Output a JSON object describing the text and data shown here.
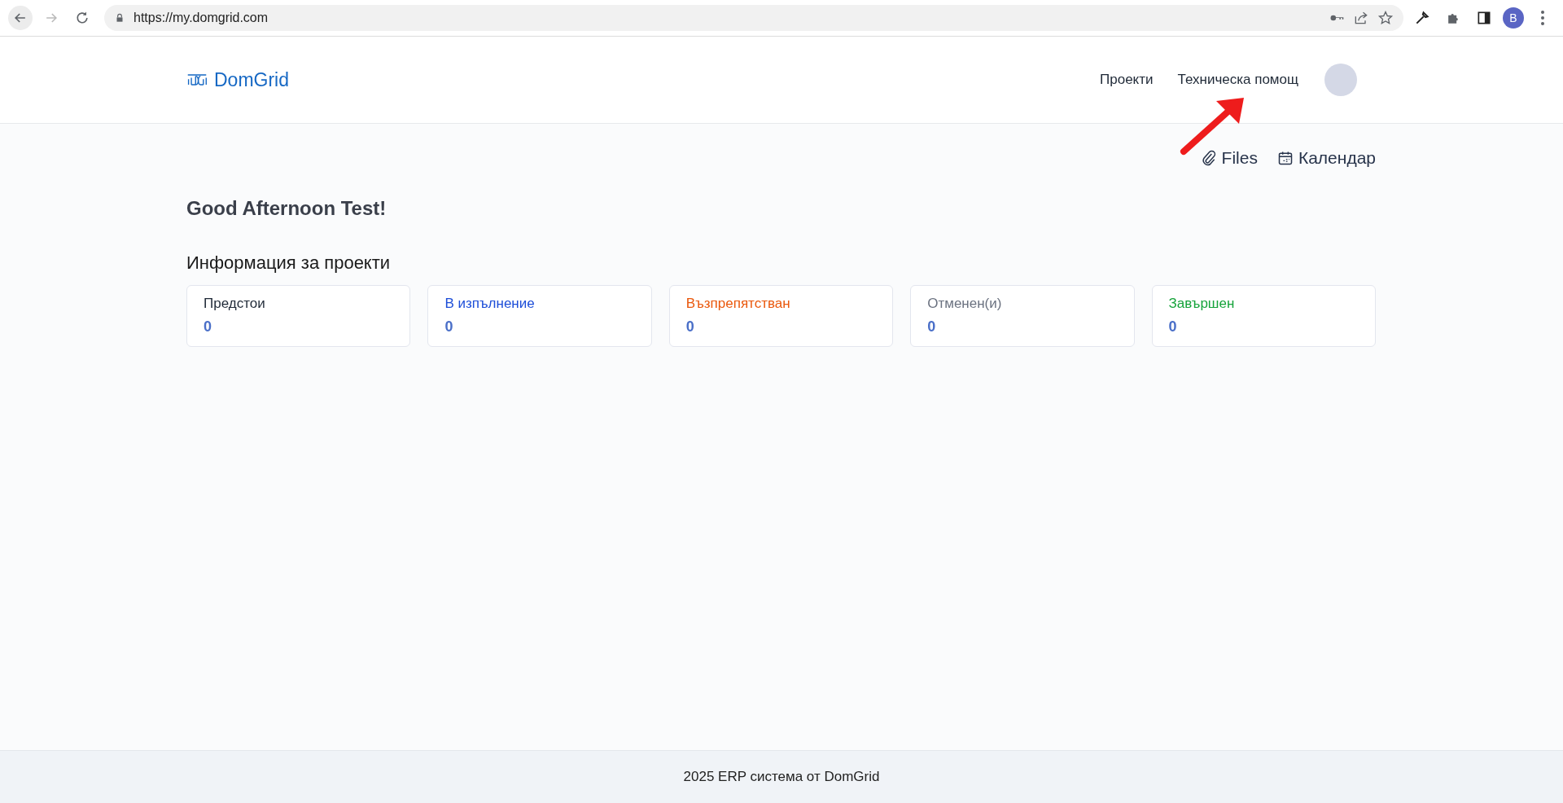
{
  "browser": {
    "url": "https://my.domgrid.com",
    "profile_initial": "B"
  },
  "header": {
    "logo": "DomGrid",
    "nav": [
      "Проекти",
      "Техническа помощ"
    ]
  },
  "quick_links": [
    {
      "kind": "files",
      "label": "Files"
    },
    {
      "kind": "calendar",
      "label": "Календар"
    }
  ],
  "greeting": "Good Afternoon Test!",
  "section_title": "Информация за проекти",
  "status_cards": [
    {
      "label": "Предстои",
      "value": "0",
      "color": "#1f2937"
    },
    {
      "label": "В изпълнение",
      "value": "0",
      "color": "#1d4ed8"
    },
    {
      "label": "Възпрепятстван",
      "value": "0",
      "color": "#ea580c"
    },
    {
      "label": "Отменен(и)",
      "value": "0",
      "color": "#6b7280"
    },
    {
      "label": "Завършен",
      "value": "0",
      "color": "#15a33a"
    }
  ],
  "footer": "2025 ERP система от DomGrid"
}
